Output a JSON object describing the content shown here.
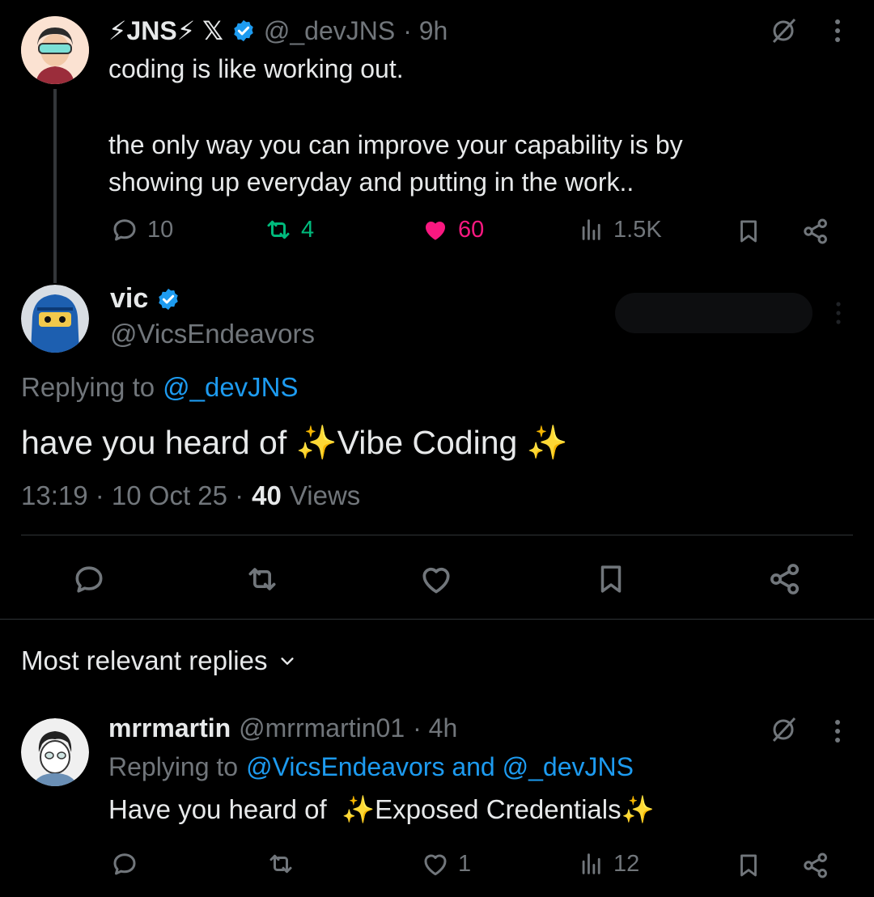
{
  "tweet1": {
    "display_name": "⚡JNS⚡ 𝕏",
    "handle": "@_devJNS",
    "time": "· 9h",
    "line1": "coding is like working out.",
    "line2": "the only way you can improve your capability is by",
    "line3": "showing up everyday and putting in the work..",
    "replies": "10",
    "reposts": "4",
    "likes": "60",
    "views": "1.5K"
  },
  "main_tweet": {
    "display_name": "vic",
    "handle": "@VicsEndeavors",
    "replying_prefix": "Replying to",
    "replying_handle": "@_devJNS",
    "text": "have you heard of ✨Vibe Coding ✨",
    "time": "13:19 · 10 Oct 25 ·",
    "views_count": "40",
    "views_label": "Views"
  },
  "replies_section": {
    "sort_label": "Most relevant replies"
  },
  "reply1": {
    "display_name": "mrrmartin",
    "handle": "@mrrmartin01",
    "time": "· 4h",
    "replying_prefix": "Replying to",
    "replying_handles": "@VicsEndeavors and @_devJNS",
    "text": "Have you heard of  ✨Exposed Credentials✨",
    "likes": "1",
    "views": "12"
  },
  "colors": {
    "background": "#000000",
    "text": "#e7e9ea",
    "muted": "#71767b",
    "link": "#1d9bf0",
    "like": "#f91880",
    "repost": "#00ba7c"
  }
}
